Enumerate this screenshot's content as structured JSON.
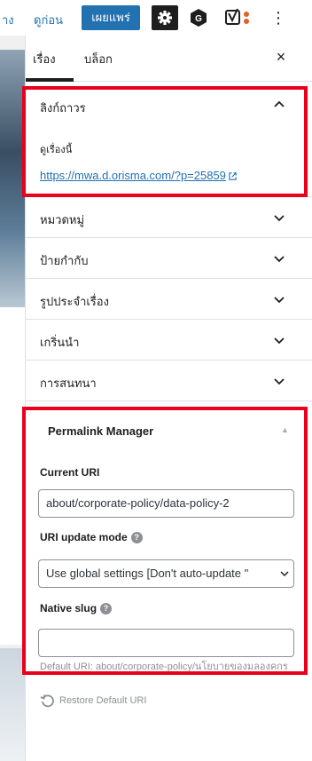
{
  "toolbar": {
    "cut_text": "าง",
    "preview_label": "ดูก่อน",
    "publish_label": "เผยแพร่",
    "settings_icon": "gear-icon",
    "more_label": "⋮"
  },
  "sidebar": {
    "tabs": [
      {
        "label": "เรื่อง",
        "active": true
      },
      {
        "label": "บล็อก",
        "active": false
      }
    ],
    "close_label": "×",
    "permalink": {
      "title": "ลิงก์ถาวร",
      "view_label": "ดูเรื่องนี้",
      "url": "https://mwa.d.orisma.com/?p=25859"
    },
    "panels": [
      {
        "title": "หมวดหมู่"
      },
      {
        "title": "ป้ายกำกับ"
      },
      {
        "title": "รูปประจำเรื่อง"
      },
      {
        "title": "เกริ่นนำ"
      },
      {
        "title": "การสนทนา"
      }
    ]
  },
  "permalink_manager": {
    "title": "Permalink Manager",
    "current_uri_label": "Current URI",
    "current_uri_value": "about/corporate-policy/data-policy-2",
    "update_mode_label": "URI update mode",
    "update_mode_value": "Use global settings [Don't auto-update \"",
    "native_slug_label": "Native slug",
    "native_slug_value": "",
    "default_uri_label": "Default URI:",
    "default_uri_value": "about/corporate-policy/นโยบายของมลองคกร",
    "restore_label": "Restore Default URI"
  },
  "colors": {
    "accent": "#2271b1",
    "highlight": "#e8001c",
    "dark": "#1e1e1e"
  }
}
